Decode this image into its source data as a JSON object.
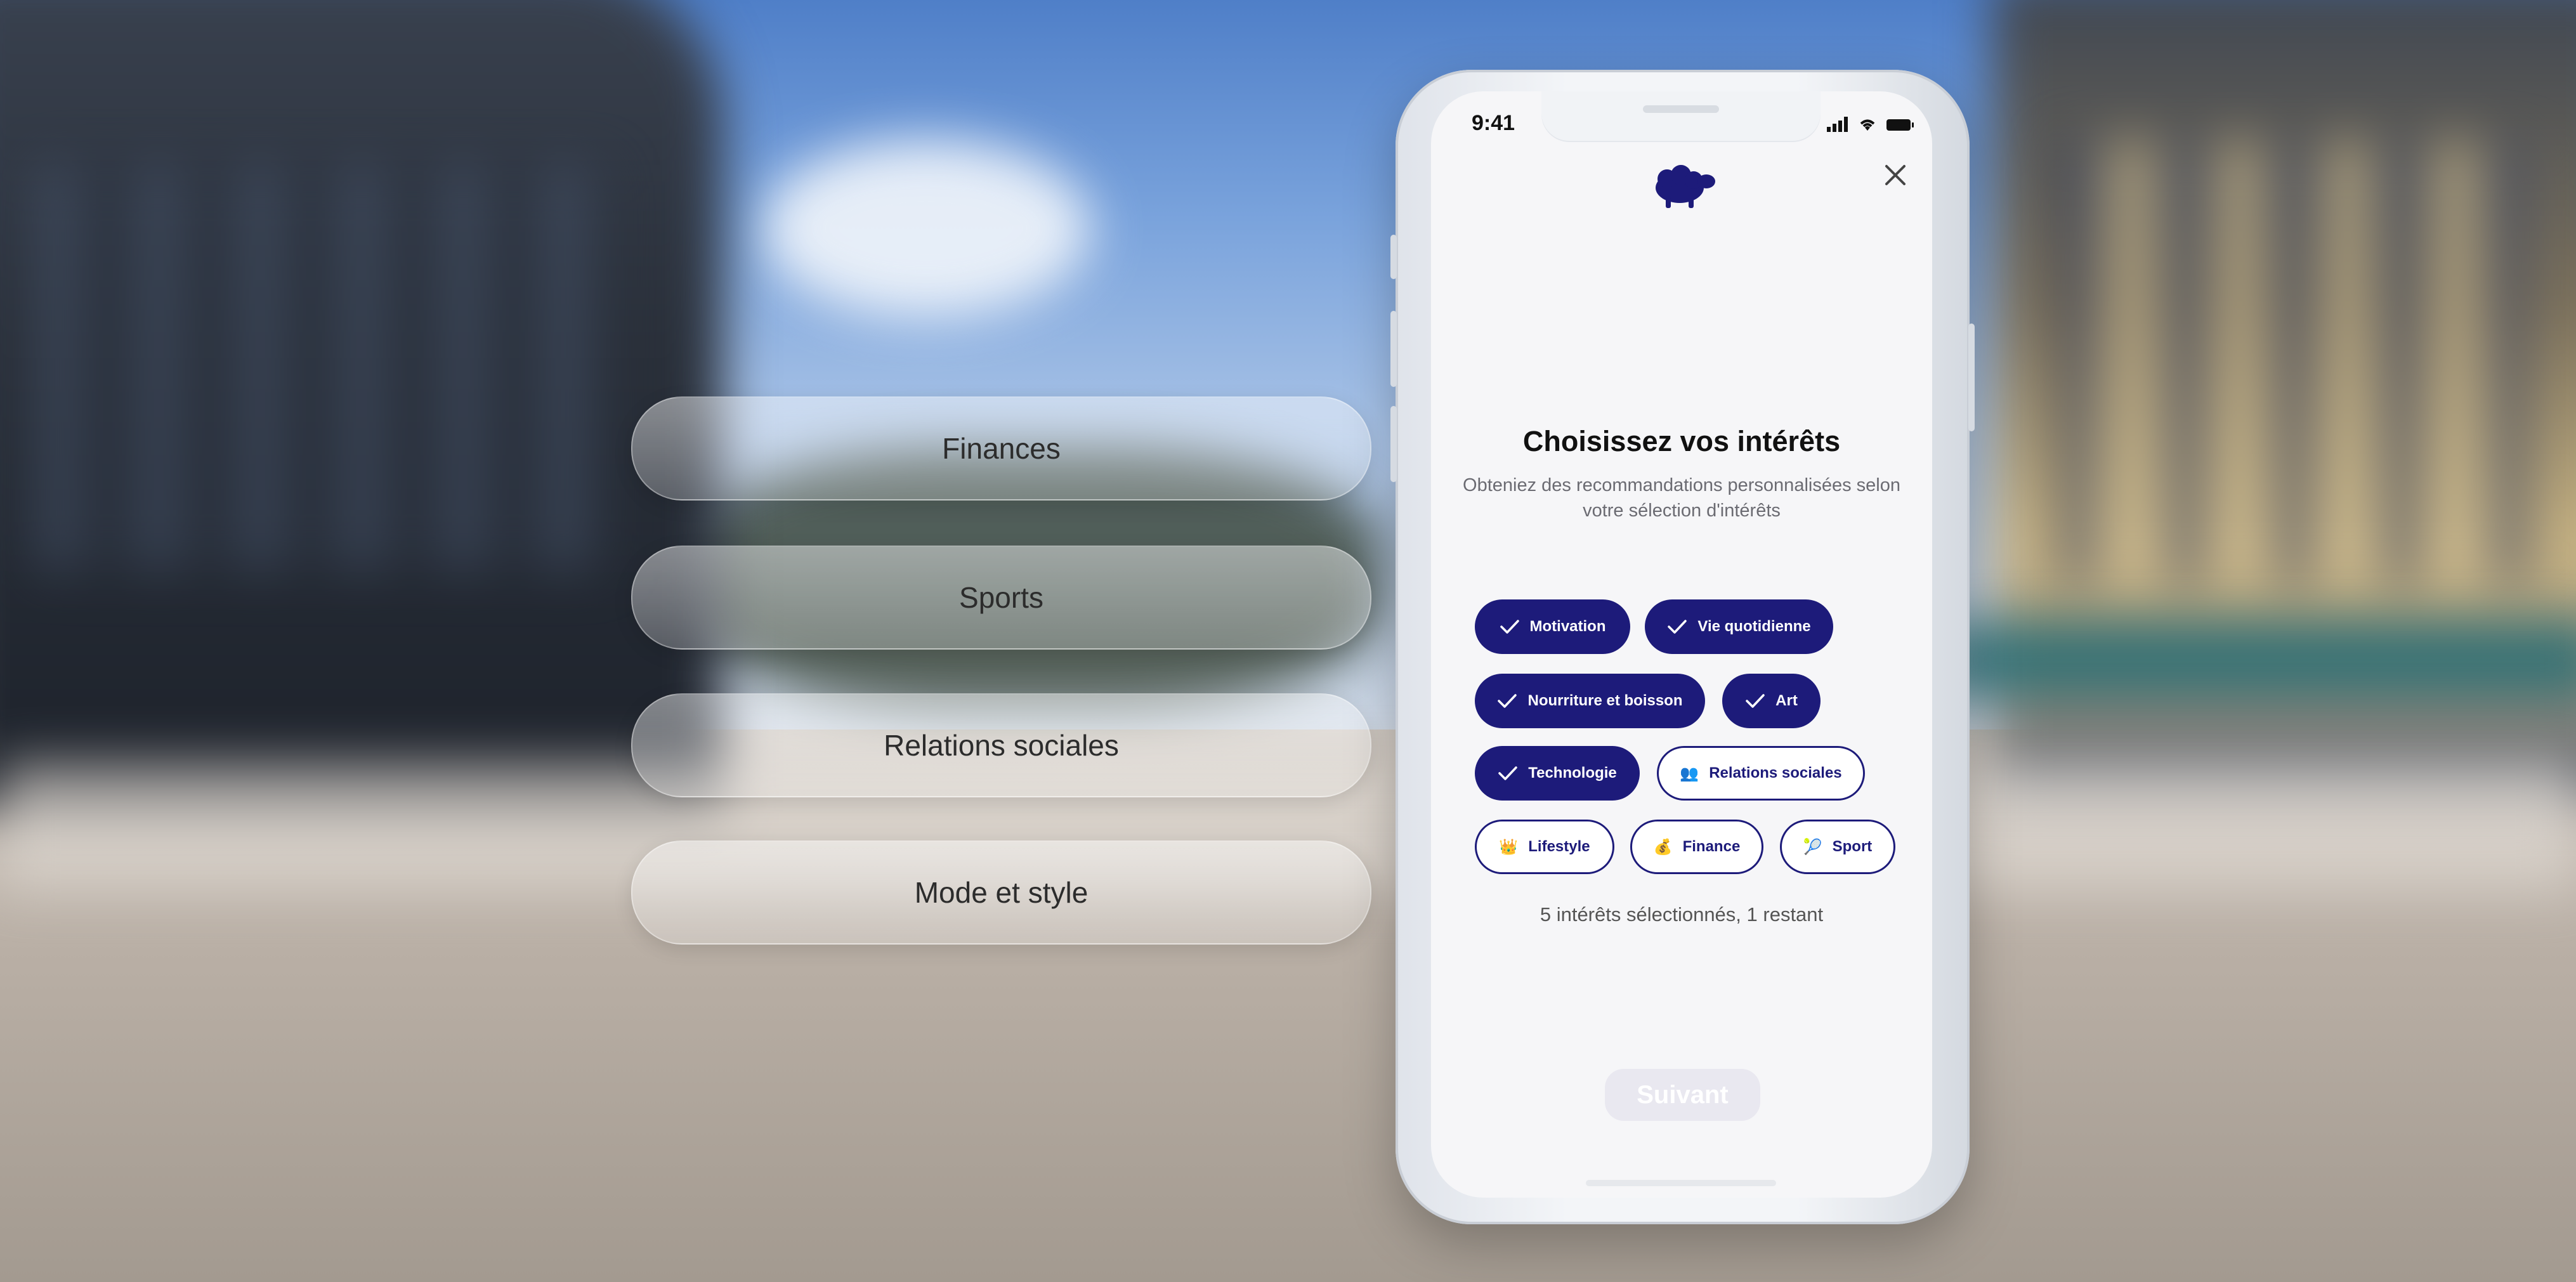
{
  "phone": {
    "status_time": "9:41",
    "title": "Choisissez vos intérêts",
    "subtitle": "Obteniez des recommandations personnalisées selon votre sélection d'intérêts",
    "chips": [
      {
        "label": "Motivation",
        "selected": true,
        "icon": "check-icon"
      },
      {
        "label": "Vie quotidienne",
        "selected": true,
        "icon": "check-icon"
      },
      {
        "label": "Nourriture et boisson",
        "selected": true,
        "icon": "check-icon"
      },
      {
        "label": "Art",
        "selected": true,
        "icon": "check-icon"
      },
      {
        "label": "Technologie",
        "selected": true,
        "icon": "check-icon"
      },
      {
        "label": "Relations sociales",
        "selected": false,
        "emoji": "👥"
      },
      {
        "label": "Lifestyle",
        "selected": false,
        "emoji": "👑"
      },
      {
        "label": "Finance",
        "selected": false,
        "emoji": "💰"
      },
      {
        "label": "Sport",
        "selected": false,
        "emoji": "🎾"
      }
    ],
    "selection_count": "5 intérêts sélectionnés, 1 restant",
    "next_label": "Suivant"
  },
  "floating": [
    {
      "label": "Finances"
    },
    {
      "label": "Sports"
    },
    {
      "label": "Relations sociales"
    },
    {
      "label": "Mode et style"
    }
  ],
  "colors": {
    "brand": "#1d1b7a",
    "chip_selected_bg": "#1d1b7a",
    "button_disabled_bg": "#e9e8f0"
  }
}
